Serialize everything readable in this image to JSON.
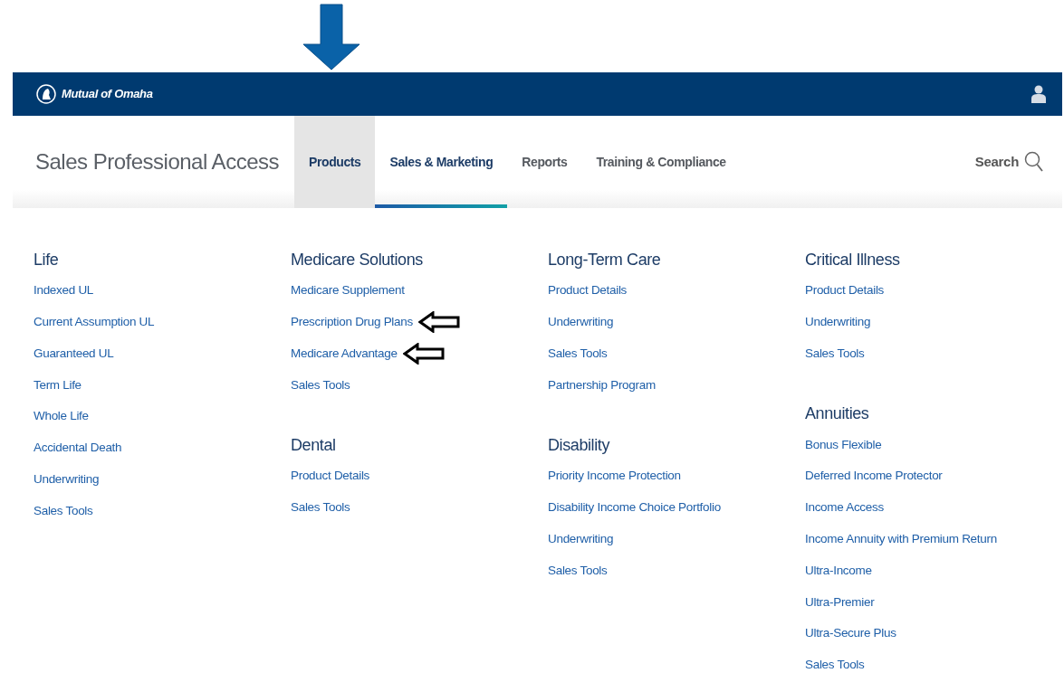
{
  "header": {
    "logo": "Mutual of Omaha"
  },
  "nav": {
    "title": "Sales Professional Access",
    "tabs": [
      {
        "label": "Products",
        "selected": true,
        "underlined": false
      },
      {
        "label": "Sales & Marketing",
        "selected": false,
        "underlined": true
      },
      {
        "label": "Reports",
        "selected": false,
        "underlined": false
      },
      {
        "label": "Training & Compliance",
        "selected": false,
        "underlined": false
      }
    ],
    "search": "Search"
  },
  "menu": {
    "columns": [
      {
        "groups": [
          {
            "heading": "Life",
            "links": [
              {
                "label": "Indexed UL",
                "marked": false
              },
              {
                "label": "Current Assumption UL",
                "marked": false
              },
              {
                "label": "Guaranteed UL",
                "marked": false
              },
              {
                "label": "Term Life",
                "marked": false
              },
              {
                "label": "Whole Life",
                "marked": false
              },
              {
                "label": "Accidental Death",
                "marked": false
              },
              {
                "label": "Underwriting",
                "marked": false
              },
              {
                "label": "Sales Tools",
                "marked": false
              }
            ]
          }
        ]
      },
      {
        "groups": [
          {
            "heading": "Medicare Solutions",
            "links": [
              {
                "label": "Medicare Supplement",
                "marked": false
              },
              {
                "label": "Prescription Drug Plans",
                "marked": true
              },
              {
                "label": "Medicare Advantage",
                "marked": true
              },
              {
                "label": "Sales Tools",
                "marked": false
              }
            ]
          },
          {
            "heading": "Dental",
            "links": [
              {
                "label": "Product Details",
                "marked": false
              },
              {
                "label": "Sales Tools",
                "marked": false
              }
            ]
          }
        ]
      },
      {
        "groups": [
          {
            "heading": "Long-Term Care",
            "links": [
              {
                "label": "Product Details",
                "marked": false
              },
              {
                "label": "Underwriting",
                "marked": false
              },
              {
                "label": "Sales Tools",
                "marked": false
              },
              {
                "label": "Partnership Program",
                "marked": false
              }
            ]
          },
          {
            "heading": "Disability",
            "links": [
              {
                "label": "Priority Income Protection",
                "marked": false
              },
              {
                "label": "Disability Income Choice Portfolio",
                "marked": false
              },
              {
                "label": "Underwriting",
                "marked": false
              },
              {
                "label": "Sales Tools",
                "marked": false
              }
            ]
          }
        ]
      },
      {
        "groups": [
          {
            "heading": "Critical Illness",
            "links": [
              {
                "label": "Product Details",
                "marked": false
              },
              {
                "label": "Underwriting",
                "marked": false
              },
              {
                "label": "Sales Tools",
                "marked": false
              }
            ]
          },
          {
            "heading": "Annuities",
            "links": [
              {
                "label": "Bonus Flexible",
                "marked": false
              },
              {
                "label": "Deferred Income Protector",
                "marked": false
              },
              {
                "label": "Income Access",
                "marked": false
              },
              {
                "label": "Income Annuity with Premium Return",
                "marked": false
              },
              {
                "label": "Ultra-Income",
                "marked": false
              },
              {
                "label": "Ultra-Premier",
                "marked": false
              },
              {
                "label": "Ultra-Secure Plus",
                "marked": false
              },
              {
                "label": "Sales Tools",
                "marked": false
              }
            ]
          }
        ]
      }
    ]
  }
}
